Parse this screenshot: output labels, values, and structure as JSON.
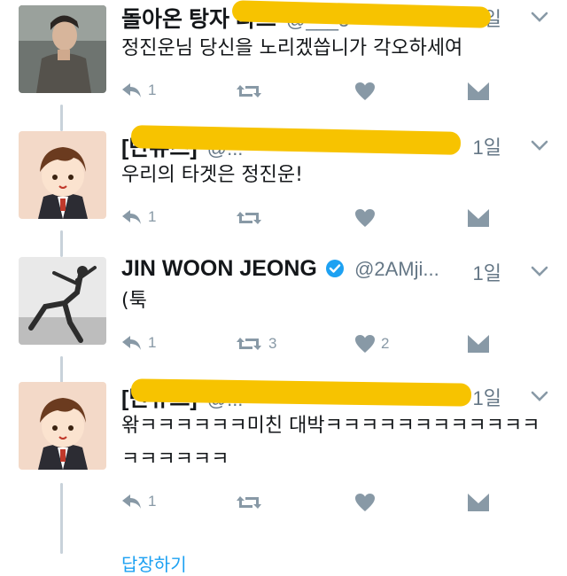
{
  "tweets": [
    {
      "name": "돌아온 탕자 라끄",
      "handle": "@___3·",
      "time": "1일",
      "text": "정진운님 당신을 노리겠씁니가 각오하세여",
      "reply_count": "1",
      "retweet_count": "",
      "like_count": ""
    },
    {
      "name": "[단유즈]",
      "handle": "@...",
      "time": "1일",
      "text": "우리의 타겟은 정진운!",
      "reply_count": "1",
      "retweet_count": "",
      "like_count": ""
    },
    {
      "name": "JIN WOON JEONG",
      "handle": "@2AMji...",
      "time": "1일",
      "text": "(툭",
      "reply_count": "1",
      "retweet_count": "3",
      "like_count": "2"
    },
    {
      "name": "[단유즈]",
      "handle": "@...",
      "time": "1일",
      "text": "왂ㅋㅋㅋㅋㅋㅋ미친 대박ㅋㅋㅋㅋㅋㅋㅋㅋㅋㅋㅋㅋㅋㅋㅋㅋㅋㅋ",
      "reply_count": "1",
      "retweet_count": "",
      "like_count": ""
    }
  ],
  "footer": {
    "link_text": "답장하기"
  },
  "colors": {
    "accent": "#1da1f2",
    "icon_gray": "#8899a6",
    "line": "#c8d2da",
    "redaction": "#f7c300"
  }
}
